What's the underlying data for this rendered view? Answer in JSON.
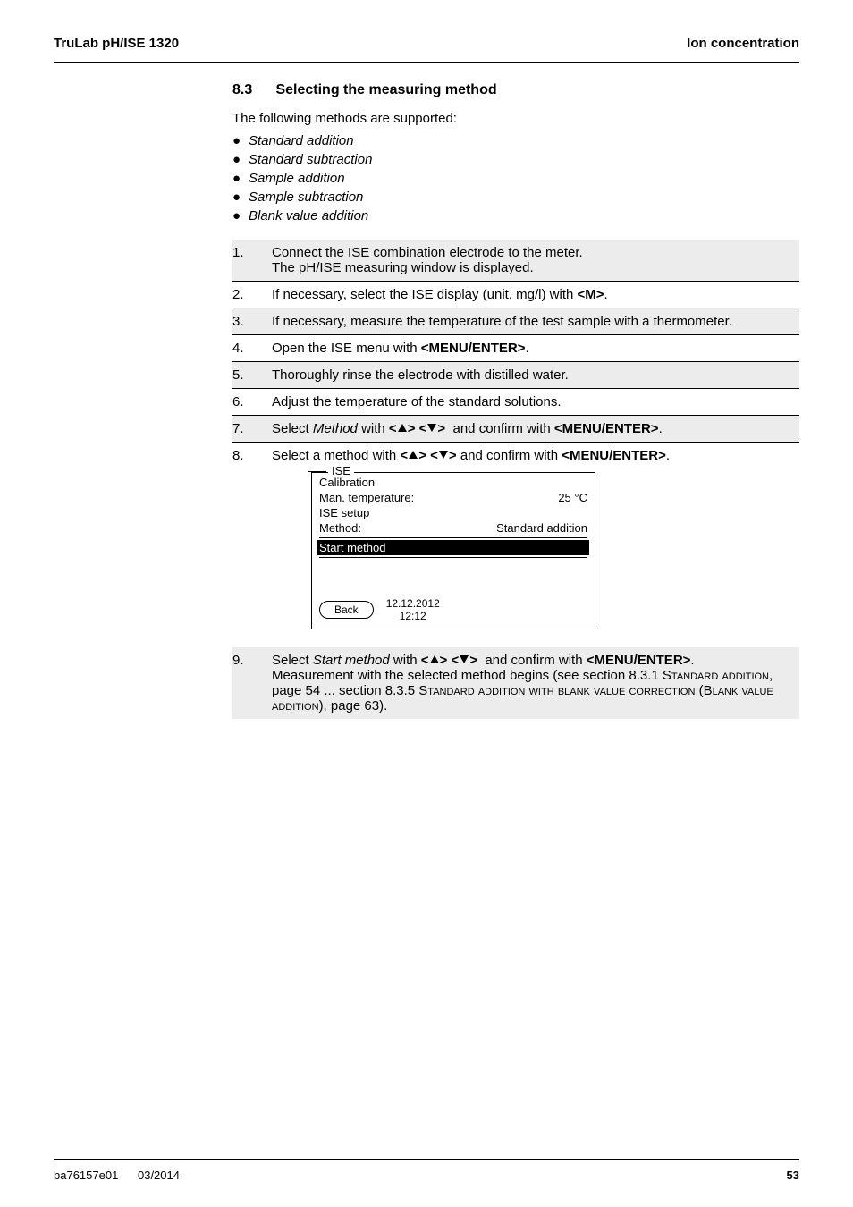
{
  "header": {
    "left": "TruLab pH/ISE 1320",
    "right": "Ion concentration"
  },
  "section": {
    "number": "8.3",
    "title": "Selecting the measuring method",
    "intro": "The following methods are supported:",
    "methods": [
      "Standard addition",
      "Standard subtraction",
      "Sample addition",
      "Sample subtraction",
      "Blank value addition"
    ]
  },
  "steps": {
    "s1": {
      "num": "1.",
      "l1": "Connect the ISE combination electrode to the meter.",
      "l2": "The pH/ISE measuring window is displayed."
    },
    "s2": {
      "num": "2.",
      "pre": "If necessary, select the ISE display (unit, mg/l) with ",
      "key": "<M>",
      "post": "."
    },
    "s3": {
      "num": "3.",
      "text": "If necessary, measure the temperature of the test sample with a thermometer."
    },
    "s4": {
      "num": "4.",
      "pre": "Open the ISE menu with ",
      "key": "<MENU/ENTER>",
      "post": "."
    },
    "s5": {
      "num": "5.",
      "text": "Thoroughly rinse the electrode with distilled water."
    },
    "s6": {
      "num": "6.",
      "text": "Adjust the temperature of the standard solutions."
    },
    "s7": {
      "num": "7.",
      "pre": "Select ",
      "it": "Method",
      "mid": " with ",
      "pre2": " and confirm with ",
      "key": "<MENU/ENTER>",
      "post": "."
    },
    "s8": {
      "num": "8.",
      "pre": "Select a method with ",
      "mid": " and confirm with ",
      "key": "<MENU/ENTER>",
      "post": "."
    },
    "s9": {
      "num": "9.",
      "pre": "Select ",
      "it": "Start method",
      "mid": " with ",
      "mid2": " and confirm with ",
      "key": "<MENU/ENTER>",
      "post": ".",
      "l2a": "Measurement with the selected method begins (see section 8.3.1 ",
      "sc1": "Standard addition",
      "l2b": ", page 54 ... section 8.3.5 ",
      "sc2": "Standard addition with blank value correction",
      "l2c": " (",
      "sc3": "Blank value addition",
      "l2d": "), page 63)."
    }
  },
  "display": {
    "legend": "ISE",
    "calibration": "Calibration",
    "man_temp_label": "Man. temperature:",
    "man_temp_value": "25  °C",
    "ise_setup": "ISE setup",
    "method_label": "Method:",
    "method_value": "Standard addition",
    "start_method": "Start method",
    "back": "Back",
    "date": "12.12.2012",
    "time": "12:12"
  },
  "footer": {
    "doc": "ba76157e01",
    "date": "03/2014",
    "page": "53"
  }
}
